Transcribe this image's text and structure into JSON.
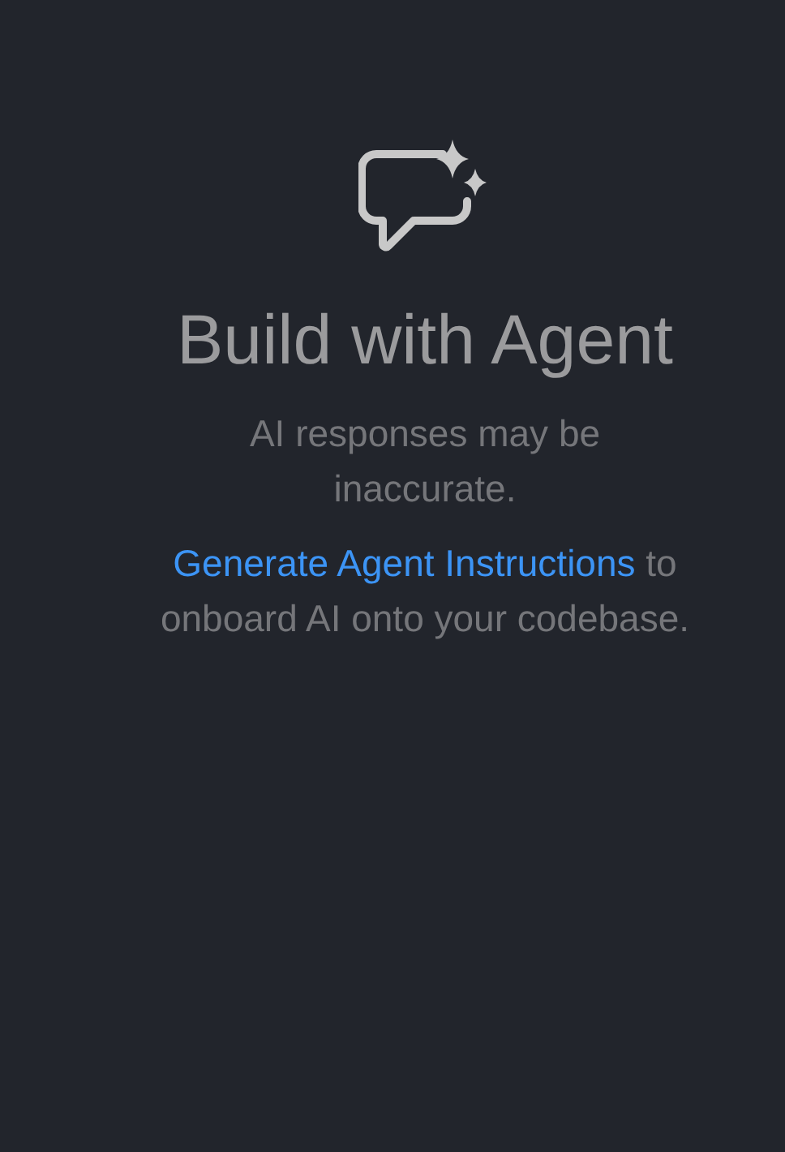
{
  "title": "Build with Agent",
  "notice": "AI responses may be inaccurate.",
  "hint": {
    "link": "Generate Agent Instructions",
    "text": " to onboard AI onto your codebase."
  }
}
